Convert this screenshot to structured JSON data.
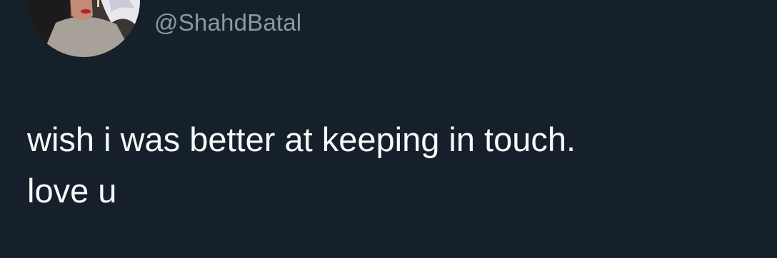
{
  "user": {
    "handle": "@ShahdBatal"
  },
  "tweet": {
    "line1": "wish i was better at keeping in touch.",
    "line2": "love u"
  },
  "colors": {
    "background": "#15202b",
    "handle_text": "#8b98a5",
    "body_text": "#f7f9f9"
  },
  "icons": {
    "avatar": "profile-photo"
  }
}
